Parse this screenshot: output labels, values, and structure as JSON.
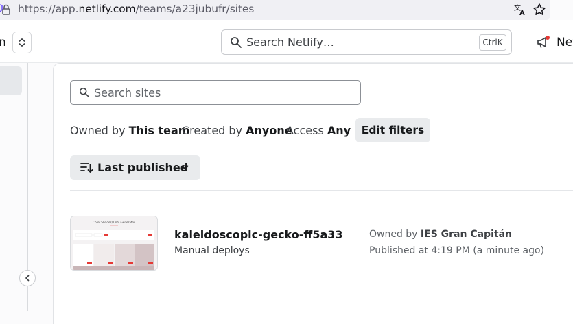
{
  "browser": {
    "url_prefix": "https://app.",
    "url_host": "netlify.com",
    "url_path": "/teams/a23jubufr/sites",
    "icons": [
      "lock-icon",
      "translate-icon",
      "star-icon"
    ]
  },
  "header": {
    "team_label_fragment": "n",
    "search_placeholder": "Search Netlify…",
    "search_shortcut": "CtrlK",
    "news_label": "New",
    "icons": [
      "chevron-updown-icon",
      "search-icon",
      "megaphone-icon"
    ]
  },
  "sites": {
    "search_placeholder": "Search sites",
    "filters": {
      "owned_label": "Owned by",
      "owned_value": "This team",
      "created_label": "Created by",
      "created_value": "Anyone",
      "access_label": "Access",
      "access_value": "Any",
      "edit_button": "Edit filters"
    },
    "sort": {
      "label": "Last published"
    },
    "list": [
      {
        "name": "kaleidoscopic-gecko-ff5a33",
        "deploy_type": "Manual deploys",
        "owned_prefix": "Owned by",
        "owner": "IES Gran Capitán",
        "published": "Published at 4:19 PM (a minute ago)",
        "thumbnail": {
          "title": "Color Shades/Tints Generator",
          "accent": "#e53935"
        }
      }
    ]
  },
  "colors": {
    "accent_red": "#e53935",
    "button_bg": "#e9ebed"
  }
}
